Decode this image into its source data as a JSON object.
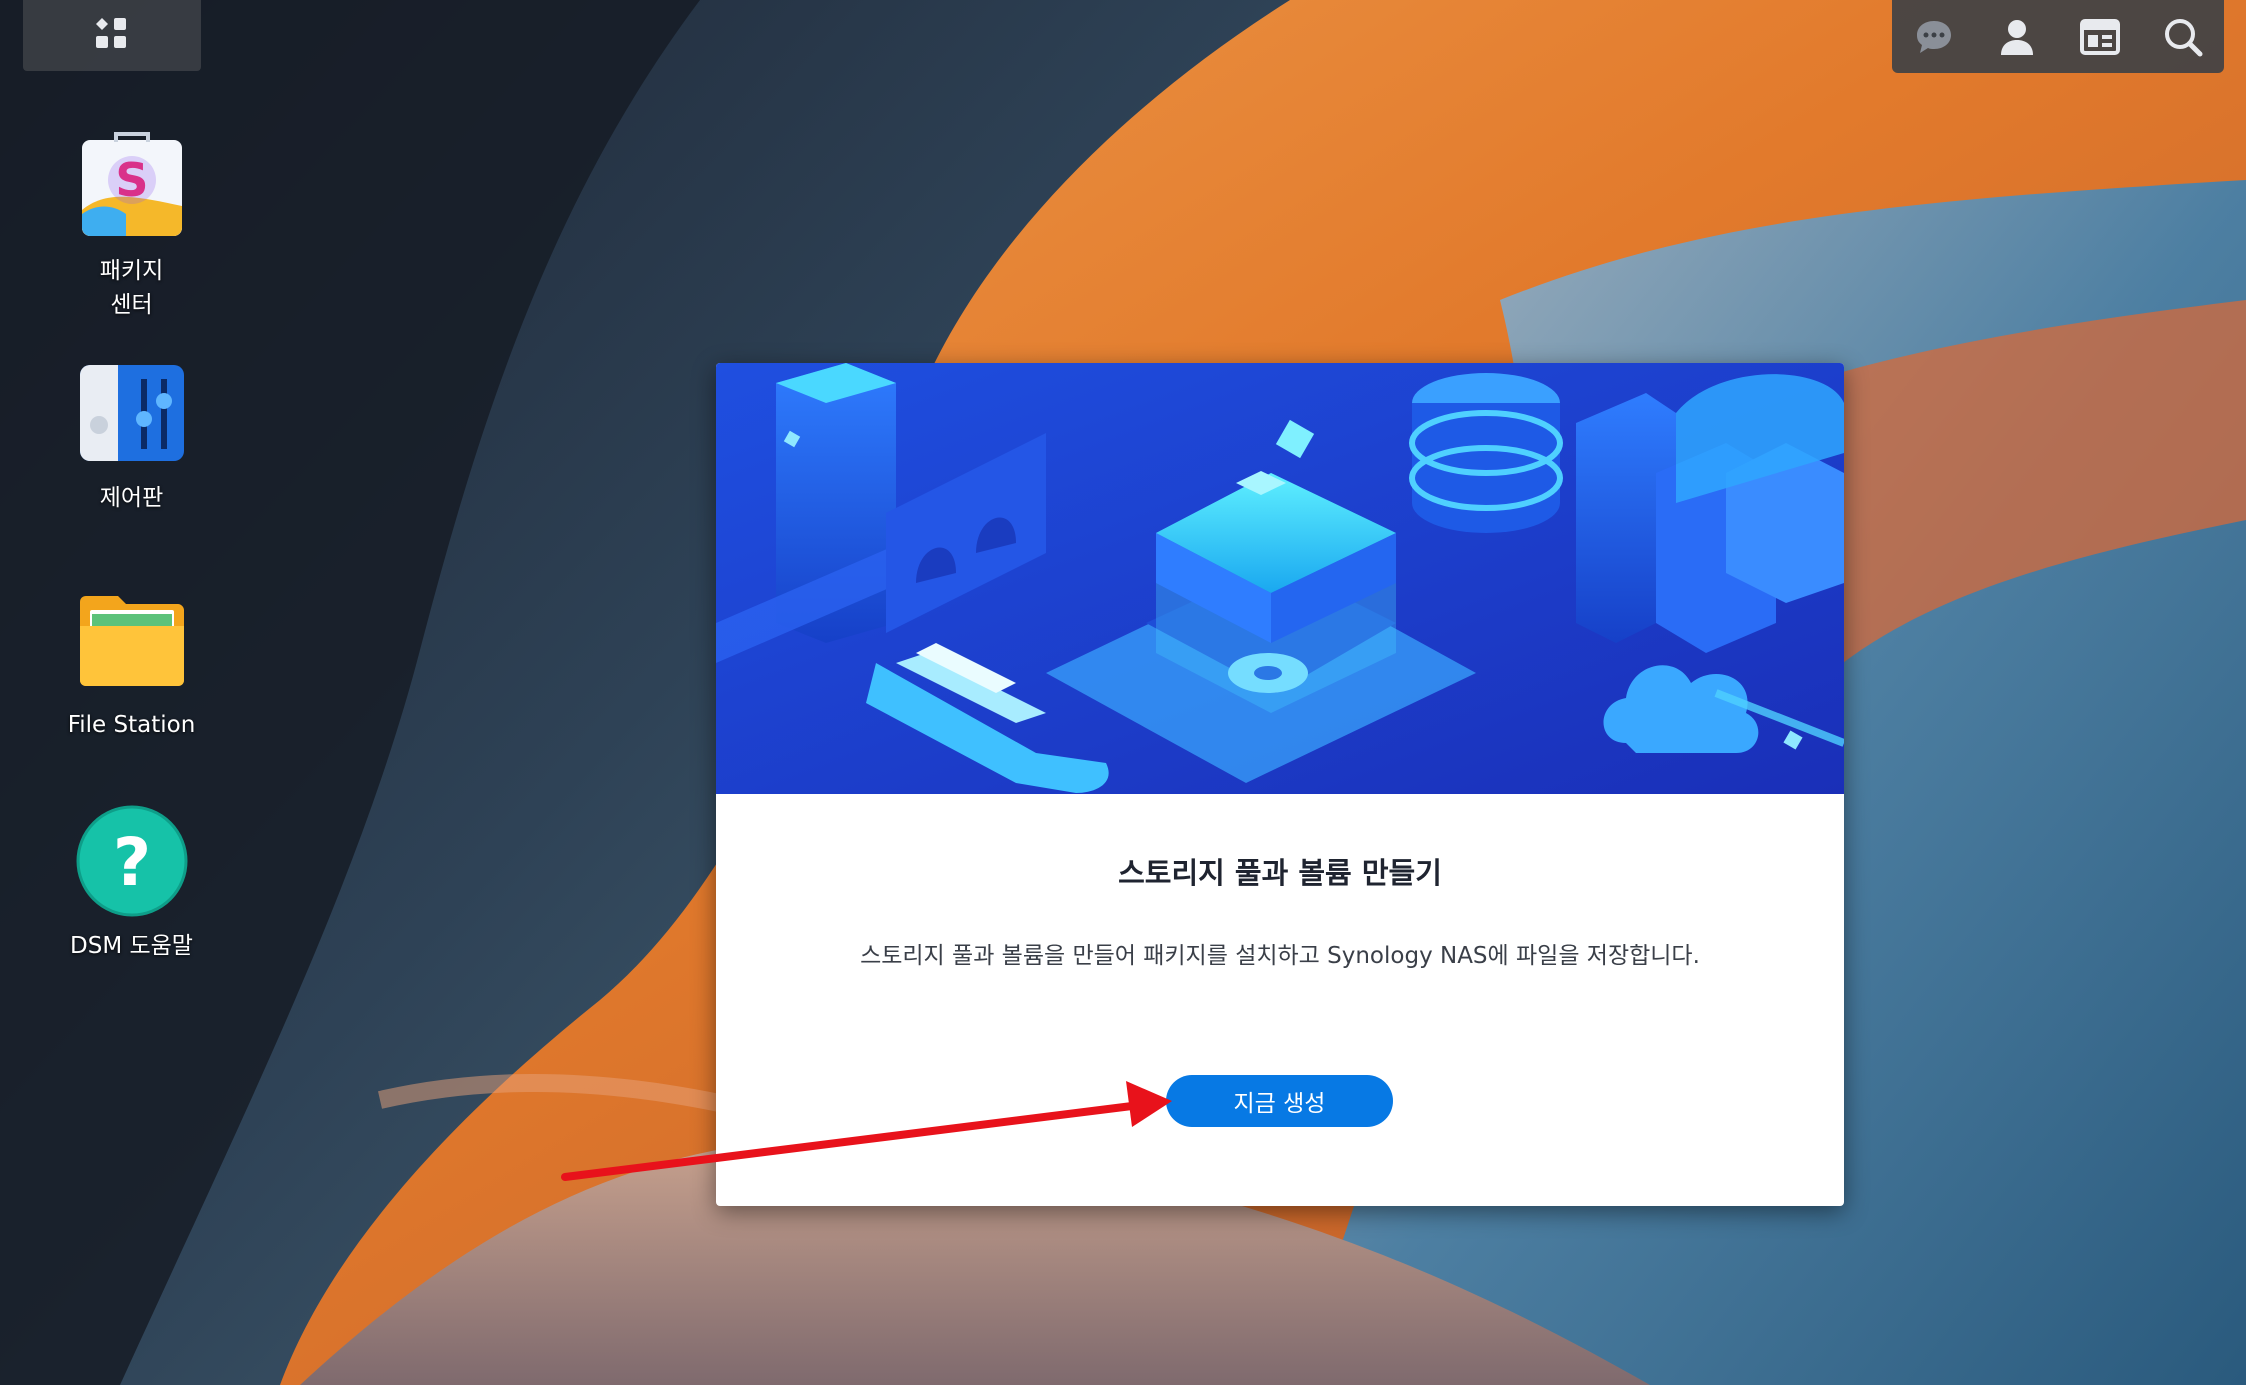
{
  "desktop": {
    "icons": [
      {
        "label": "패키지\n센터",
        "icon": "package-center-icon"
      },
      {
        "label": "제어판",
        "icon": "control-panel-icon"
      },
      {
        "label": "File Station",
        "icon": "file-station-icon"
      },
      {
        "label": "DSM 도움말",
        "icon": "help-icon"
      }
    ]
  },
  "taskbar": {
    "main_menu_icon": "main-menu-icon",
    "right_icons": [
      "chat-icon",
      "user-icon",
      "widgets-icon",
      "search-icon"
    ]
  },
  "dialog": {
    "title": "스토리지 풀과 볼륨 만들기",
    "description": "스토리지 풀과 볼륨을 만들어 패키지를 설치하고 Synology NAS에 파일을 저장합니다.",
    "button_label": "지금 생성"
  },
  "colors": {
    "accent": "#0779e4",
    "annotation_arrow": "#e8121b"
  }
}
